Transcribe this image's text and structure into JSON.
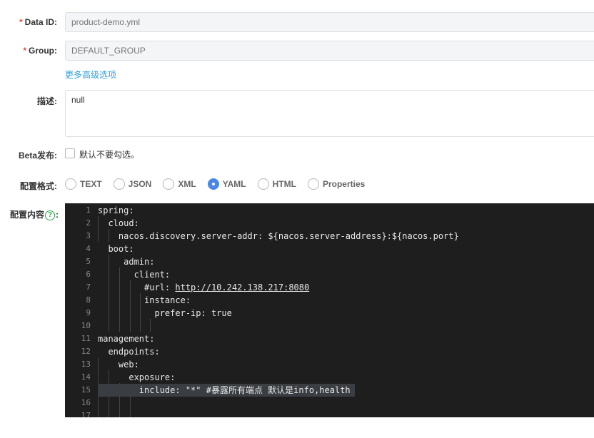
{
  "form": {
    "data_id": {
      "label": "Data ID:",
      "placeholder": "product-demo.yml",
      "required": true
    },
    "group": {
      "label": "Group:",
      "placeholder": "DEFAULT_GROUP",
      "required": true
    },
    "advanced_link": "更多高级选项",
    "description": {
      "label": "描述:",
      "value": "null"
    },
    "beta": {
      "label": "Beta发布:",
      "checkbox_label": "默认不要勾选。"
    },
    "format": {
      "label": "配置格式:",
      "options": [
        "TEXT",
        "JSON",
        "XML",
        "YAML",
        "HTML",
        "Properties"
      ],
      "selected": "YAML"
    },
    "content": {
      "label_prefix": "配置内容",
      "label_suffix": ":"
    }
  },
  "editor": {
    "lines": [
      {
        "num": "1",
        "text": "spring:"
      },
      {
        "num": "2",
        "text": "  cloud:"
      },
      {
        "num": "3",
        "text": "    nacos.discovery.server-addr: ${nacos.server-address}:${nacos.port}"
      },
      {
        "num": "4",
        "text": "  boot:"
      },
      {
        "num": "5",
        "text": "     admin:"
      },
      {
        "num": "6",
        "text": "       client:"
      },
      {
        "num": "7",
        "text": "         #url: ",
        "url": "http://10.242.138.217:8080"
      },
      {
        "num": "8",
        "text": "         instance:"
      },
      {
        "num": "9",
        "text": "           prefer-ip: true"
      },
      {
        "num": "10",
        "text": ""
      },
      {
        "num": "11",
        "text": "management:"
      },
      {
        "num": "12",
        "text": "  endpoints:"
      },
      {
        "num": "13",
        "text": "    web:"
      },
      {
        "num": "14",
        "text": "      exposure:"
      },
      {
        "num": "15",
        "text": "        include: \"*\" #暴露所有端点 默认是info,health",
        "highlight": true
      },
      {
        "num": "16",
        "text": ""
      },
      {
        "num": "17",
        "text": ""
      }
    ]
  }
}
